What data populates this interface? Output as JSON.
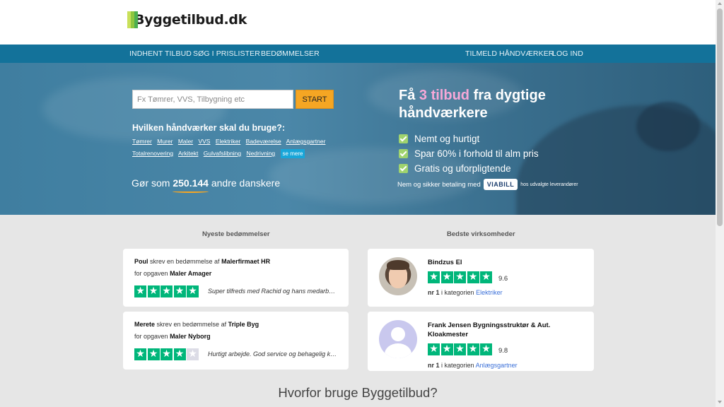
{
  "header": {
    "logo_text": "Byggetilbud.dk"
  },
  "nav": {
    "left": [
      "INDHENT TILBUD",
      "SØG I PRISLISTER",
      "BEDØMMELSER"
    ],
    "right": [
      "TILMELD HÅNDVÆRKER",
      "LOG IND"
    ]
  },
  "hero": {
    "search_placeholder": "Fx Tømrer, VVS, Tilbygning etc",
    "start_label": "START",
    "question": "Hvilken håndværker skal du bruge?:",
    "trades": [
      "Tømrer",
      "Murer",
      "Maler",
      "VVS",
      "Elektriker",
      "Badeværelse",
      "Anlægsgartner",
      "Totalrenovering",
      "Arkitekt",
      "Gulvafslibning",
      "Nedrivning"
    ],
    "see_more": "se mere",
    "gor_som_prefix": "Gør som",
    "gor_som_count": "250.144",
    "gor_som_suffix": "andre danskere",
    "title_pre": "Få",
    "title_highlight": "3 tilbud",
    "title_post": "fra dygtige håndværkere",
    "benefits": [
      "Nemt og hurtigt",
      "Spar 60% i forhold til alm pris",
      "Gratis og uforpligtende"
    ],
    "payment_prefix": "Nem og sikker betaling med",
    "payment_logo": "VIABILL",
    "payment_suffix": "hos udvalgte leverandører",
    "colors": {
      "accent_pink": "#f7a8d8",
      "start_orange": "#f5a623",
      "check_green": "#9fd36e"
    }
  },
  "reviews": {
    "title": "Nyeste bedømmelser",
    "items": [
      {
        "author": "Poul",
        "mid": "skrev en bedømmelse af",
        "company": "Malerfirmaet HR",
        "task_prefix": "for opgaven",
        "task": "Maler Amager",
        "rating": 5,
        "quote": "Super tilfreds med Rachid og hans medarbejdere"
      },
      {
        "author": "Merete",
        "mid": "skrev en bedømmelse af",
        "company": "Triple Byg",
        "task_prefix": "for opgaven",
        "task": "Maler Nyborg",
        "rating": 4,
        "quote": "Hurtigt arbejde. God service og behagelig kontakt"
      }
    ]
  },
  "businesses": {
    "title": "Bedste virksomheder",
    "items": [
      {
        "name": "Bindzus El",
        "rating": 5,
        "score": "9.6",
        "rank_label": "nr 1",
        "rank_mid": "i kategorien",
        "category": "Elektriker",
        "avatar": "photo"
      },
      {
        "name": "Frank Jensen Bygningsstruktør & Aut. Kloakmester",
        "rating": 5,
        "score": "9.8",
        "rank_label": "nr 1",
        "rank_mid": "i kategorien",
        "category": "Anlægsgartner",
        "avatar": "generic"
      }
    ]
  },
  "why_title": "Hvorfor bruge Byggetilbud?"
}
